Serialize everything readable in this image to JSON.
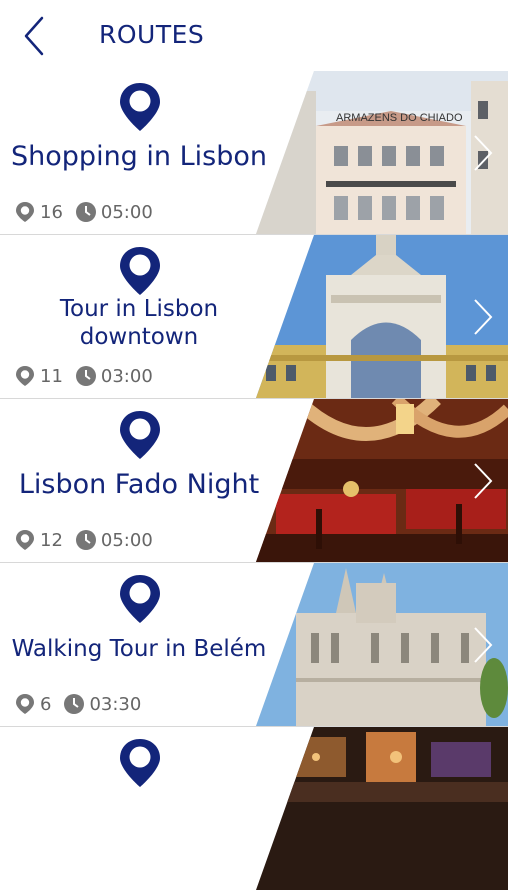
{
  "header": {
    "title": "ROUTES"
  },
  "routes": [
    {
      "title": "Shopping in Lisbon",
      "points": "16",
      "duration": "05:00",
      "photo": "chiado",
      "sign": "ARMAZENS DO CHIADO"
    },
    {
      "title": "Tour in Lisbon downtown",
      "points": "11",
      "duration": "03:00",
      "photo": "arch"
    },
    {
      "title": "Lisbon Fado Night",
      "points": "12",
      "duration": "05:00",
      "photo": "fado"
    },
    {
      "title": "Walking Tour in Belém",
      "points": "6",
      "duration": "03:30",
      "photo": "belem"
    },
    {
      "title": "",
      "points": "",
      "duration": "",
      "photo": "bar"
    }
  ],
  "colors": {
    "brand": "#13257a",
    "stat_gray": "#666666"
  }
}
